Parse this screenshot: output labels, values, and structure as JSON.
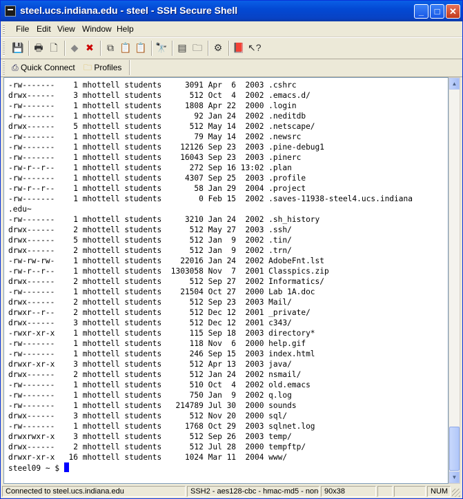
{
  "window": {
    "title": "steel.ucs.indiana.edu - steel - SSH Secure Shell"
  },
  "menu": [
    "File",
    "Edit",
    "View",
    "Window",
    "Help"
  ],
  "toolbar2": {
    "quick_connect": "Quick Connect",
    "profiles": "Profiles"
  },
  "terminal": {
    "lines": [
      "-rw-------    1 mhottell students     3091 Apr  6  2003 .cshrc",
      "drwx------    3 mhottell students      512 Oct  4  2002 .emacs.d/",
      "-rw-------    1 mhottell students     1808 Apr 22  2000 .login",
      "-rw-------    1 mhottell students       92 Jan 24  2002 .neditdb",
      "drwx------    5 mhottell students      512 May 14  2002 .netscape/",
      "-rw-------    1 mhottell students       79 May 14  2002 .newsrc",
      "-rw-------    1 mhottell students    12126 Sep 23  2003 .pine-debug1",
      "-rw-------    1 mhottell students    16043 Sep 23  2003 .pinerc",
      "-rw-r--r--    1 mhottell students      272 Sep 16 13:02 .plan",
      "-rw-------    1 mhottell students     4307 Sep 25  2003 .profile",
      "-rw-r--r--    1 mhottell students       58 Jan 29  2004 .project",
      "-rw-------    1 mhottell students        0 Feb 15  2002 .saves-11938-steel4.ucs.indiana",
      ".edu~",
      "-rw-------    1 mhottell students     3210 Jan 24  2002 .sh_history",
      "drwx------    2 mhottell students      512 May 27  2003 .ssh/",
      "drwx------    5 mhottell students      512 Jan  9  2002 .tin/",
      "drwx------    2 mhottell students      512 Jan  9  2002 .trn/",
      "-rw-rw-rw-    1 mhottell students    22016 Jan 24  2002 AdobeFnt.lst",
      "-rw-r--r--    1 mhottell students  1303058 Nov  7  2001 Classpics.zip",
      "drwx------    2 mhottell students      512 Sep 27  2002 Informatics/",
      "-rw-------    1 mhottell students    21504 Oct 27  2000 Lab 1A.doc",
      "drwx------    2 mhottell students      512 Sep 23  2003 Mail/",
      "drwxr--r--    2 mhottell students      512 Dec 12  2001 _private/",
      "drwx------    3 mhottell students      512 Dec 12  2001 c343/",
      "-rwxr-xr-x    1 mhottell students      115 Sep 18  2003 directory*",
      "-rw-------    1 mhottell students      118 Nov  6  2000 help.gif",
      "-rw-------    1 mhottell students      246 Sep 15  2003 index.html",
      "drwxr-xr-x    3 mhottell students      512 Apr 13  2003 java/",
      "drwx------    2 mhottell students      512 Jan 24  2002 nsmail/",
      "-rw-------    1 mhottell students      510 Oct  4  2002 old.emacs",
      "-rw-------    1 mhottell students      750 Jan  9  2002 q.log",
      "-rw-------    1 mhottell students   214789 Jul 30  2000 sounds",
      "drwx------    3 mhottell students      512 Nov 20  2000 sql/",
      "-rw-------    1 mhottell students     1768 Oct 29  2003 sqlnet.log",
      "drwxrwxr-x    3 mhottell students      512 Sep 26  2003 temp/",
      "drwx------    2 mhottell students      512 Jul 28  2000 tempftp/",
      "drwxr-xr-x   16 mhottell students     1024 Mar 11  2004 www/"
    ],
    "prompt": "steel09 ~ $ "
  },
  "status": {
    "connection": "Connected to steel.ucs.indiana.edu",
    "cipher": "SSH2 - aes128-cbc - hmac-md5 - none",
    "size": "90x38",
    "num": "NUM"
  },
  "icons": {
    "save": "save-icon",
    "print": "print-icon",
    "find": "find-icon",
    "settings": "settings-icon",
    "help": "help-icon"
  }
}
